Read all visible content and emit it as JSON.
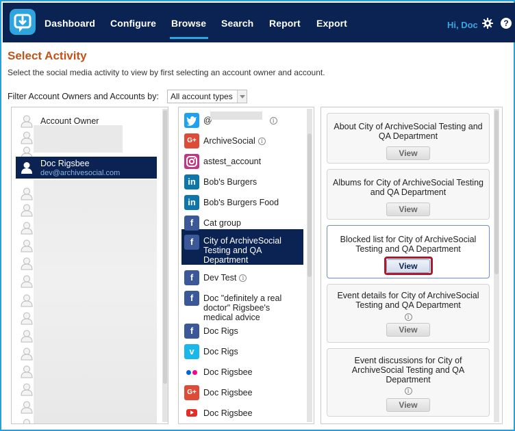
{
  "nav": {
    "items": [
      "Dashboard",
      "Configure",
      "Browse",
      "Search",
      "Report",
      "Export"
    ],
    "active": "Browse",
    "greeting": "Hi, Doc",
    "help_label": "?"
  },
  "page": {
    "title": "Select Activity",
    "instructions": "Select the social media activity to view by first selecting an account owner and account.",
    "filter_label": "Filter Account Owners and Accounts by:",
    "filter_value": "All account types"
  },
  "owners": {
    "header": "Account Owner",
    "selected": {
      "name": "Doc Rigsbee",
      "email": "dev@archivesocial.com"
    }
  },
  "accounts": [
    {
      "label": "@",
      "icon": "twitter-icon",
      "info": true
    },
    {
      "label": "ArchiveSocial",
      "icon": "google-plus-icon",
      "info": true
    },
    {
      "label": "astest_account",
      "icon": "instagram-icon",
      "info": false
    },
    {
      "label": "Bob's Burgers",
      "icon": "linkedin-icon",
      "info": false
    },
    {
      "label": "Bob's Burgers Food",
      "icon": "linkedin-icon",
      "info": false
    },
    {
      "label": "Cat group",
      "icon": "facebook-icon",
      "info": false
    },
    {
      "label": "City of ArchiveSocial Testing and QA Department",
      "icon": "facebook-icon",
      "info": false,
      "selected": true
    },
    {
      "label": "Dev Test",
      "icon": "facebook-icon",
      "info": true
    },
    {
      "label": "Doc \"definitely a real doctor\" Rigsbee's medical advice",
      "icon": "facebook-icon",
      "info": false
    },
    {
      "label": "Doc Rigs",
      "icon": "facebook-icon",
      "info": false
    },
    {
      "label": "Doc Rigs",
      "icon": "vimeo-icon",
      "info": false
    },
    {
      "label": "Doc Rigsbee",
      "icon": "flickr-icon",
      "info": false
    },
    {
      "label": "Doc Rigsbee",
      "icon": "google-plus-icon",
      "info": false
    },
    {
      "label": "Doc Rigsbee",
      "icon": "youtube-icon",
      "info": false
    }
  ],
  "activities": [
    {
      "title": "About City of ArchiveSocial Testing and QA Department",
      "button": "View"
    },
    {
      "title": "Albums for City of ArchiveSocial Testing and QA Department",
      "button": "View"
    },
    {
      "title": "Blocked list for City of ArchiveSocial Testing and QA Department",
      "button": "View",
      "active": true
    },
    {
      "title": "Event details for City of ArchiveSocial Testing and QA Department",
      "button": "View",
      "info": true
    },
    {
      "title": "Event discussions for City of ArchiveSocial Testing and QA Department",
      "button": "View",
      "info": true
    }
  ],
  "info_glyph": "i",
  "colors": {
    "nav_bg": "#0a2353",
    "accent": "#2ea6dd",
    "title": "#c0531a",
    "focus_ring": "#b0192b"
  }
}
